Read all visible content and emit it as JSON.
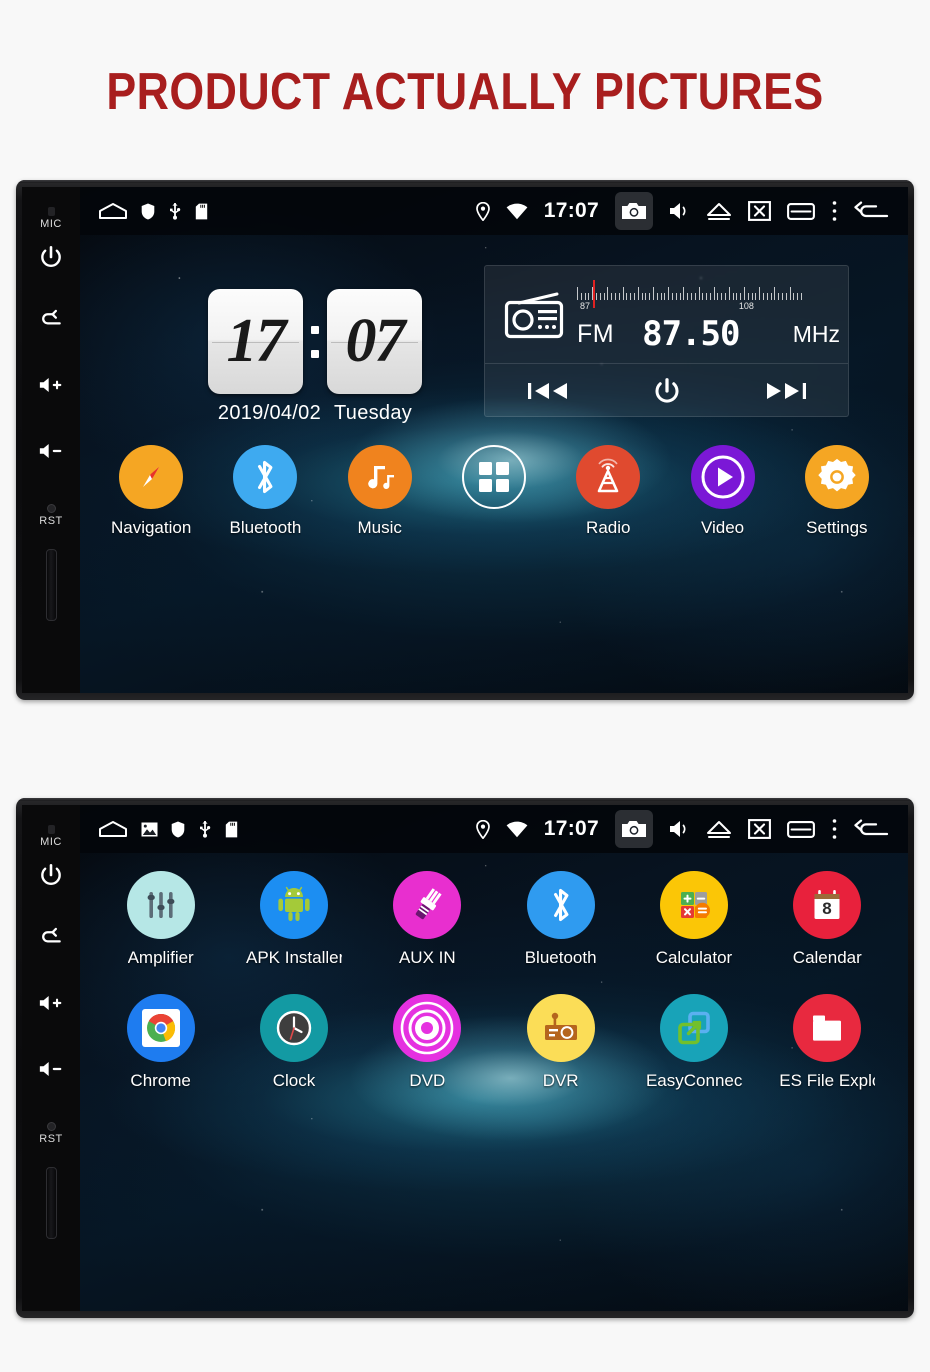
{
  "page": {
    "title": "PRODUCT ACTUALLY PICTURES",
    "title_color": "#a81e1e",
    "background": "#f8f8f8"
  },
  "device1": {
    "side_buttons": {
      "mic_label": "MIC",
      "reset_label": "RST",
      "icons": [
        "power-icon",
        "back-icon",
        "volume-up-icon",
        "volume-down-icon"
      ]
    },
    "statusbar": {
      "left_icons": [
        "home-icon",
        "shield-icon",
        "usb-icon",
        "sdcard-icon"
      ],
      "location_icon": "location-pin-icon",
      "wifi_icon": "wifi-icon",
      "time": "17:07",
      "right_icons": [
        "camera-icon",
        "volume-icon",
        "eject-icon",
        "screenshot-icon",
        "recents-icon",
        "overflow-menu-icon",
        "back-icon"
      ]
    },
    "clock_widget": {
      "hours": "17",
      "minutes": "07",
      "date": "2019/04/02",
      "weekday": "Tuesday"
    },
    "radio_widget": {
      "icon": "radio-icon",
      "band": "FM",
      "frequency": "87.50",
      "unit": "MHz",
      "scale_min": "87",
      "scale_max": "108",
      "controls": [
        "prev-track-button",
        "power-button",
        "next-track-button"
      ]
    },
    "dock": [
      {
        "label": "Navigation",
        "icon": "compass-icon",
        "color": "#f5a623"
      },
      {
        "label": "Bluetooth",
        "icon": "bluetooth-icon",
        "color": "#3eaaf0"
      },
      {
        "label": "Music",
        "icon": "music-note-icon",
        "color": "#f0831e"
      },
      {
        "label": "",
        "icon": "app-drawer-icon",
        "color": "transparent"
      },
      {
        "label": "Radio",
        "icon": "radio-tower-icon",
        "color": "#e04a2f"
      },
      {
        "label": "Video",
        "icon": "play-icon",
        "color": "#7b18d6"
      },
      {
        "label": "Settings",
        "icon": "gear-icon",
        "color": "#f5a623"
      }
    ]
  },
  "device2": {
    "side_buttons": {
      "mic_label": "MIC",
      "reset_label": "RST",
      "icons": [
        "power-icon",
        "back-icon",
        "volume-up-icon",
        "volume-down-icon"
      ]
    },
    "statusbar": {
      "left_icons": [
        "home-icon",
        "image-icon",
        "shield-icon",
        "usb-icon",
        "sdcard-icon"
      ],
      "location_icon": "location-pin-icon",
      "wifi_icon": "wifi-icon",
      "time": "17:07",
      "right_icons": [
        "camera-icon",
        "volume-icon",
        "eject-icon",
        "screenshot-icon",
        "recents-icon",
        "overflow-menu-icon",
        "back-icon"
      ]
    },
    "apps_row1": [
      {
        "label": "Amplifier",
        "icon": "equalizer-icon",
        "color": "#b6e7e6"
      },
      {
        "label": "APK Installer",
        "icon": "android-robot-icon",
        "color": "#1c8ef2"
      },
      {
        "label": "AUX IN",
        "icon": "aux-plug-icon",
        "color": "#e82fcf"
      },
      {
        "label": "Bluetooth",
        "icon": "bluetooth-icon",
        "color": "#2f9bf0"
      },
      {
        "label": "Calculator",
        "icon": "calculator-icon",
        "color": "#fbc606"
      },
      {
        "label": "Calendar",
        "icon": "calendar-icon",
        "color": "#e8213c",
        "day": "8"
      }
    ],
    "apps_row2": [
      {
        "label": "Chrome",
        "icon": "chrome-icon",
        "color": "#1e7cf0"
      },
      {
        "label": "Clock",
        "icon": "analog-clock-icon",
        "color": "#139aa3"
      },
      {
        "label": "DVD",
        "icon": "disc-icon",
        "color": "#e531e0"
      },
      {
        "label": "DVR",
        "icon": "dash-camera-icon",
        "color": "#fbdd57"
      },
      {
        "label": "EasyConnecti",
        "icon": "easyconnection-icon",
        "color": "#18a3b8"
      },
      {
        "label": "ES File Explor",
        "icon": "folder-icon",
        "color": "#e8293f"
      }
    ]
  }
}
